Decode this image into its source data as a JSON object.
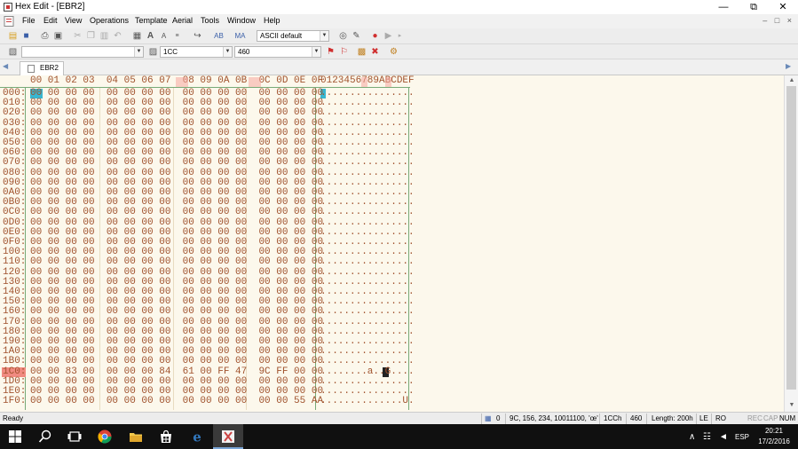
{
  "window": {
    "title": "Hex Edit - [EBR2]",
    "minimize": "—",
    "maximize": "⧉",
    "close": "✕"
  },
  "menu": {
    "items": [
      "File",
      "Edit",
      "View",
      "Operations",
      "Template",
      "Aerial",
      "Tools",
      "Window",
      "Help"
    ],
    "mdi_controls": "– □ ×"
  },
  "toolbar1": {
    "charset_combo": "ASCII default"
  },
  "toolbar2": {
    "search_combo": "",
    "address_combo": "1CC",
    "value_combo": "460"
  },
  "tabs": [
    {
      "label": "EBR2",
      "active": true
    }
  ],
  "hex": {
    "header_hex": "00 01 02 03  04 05 06 07  08 09 0A 0B  0C 0D 0E 0F",
    "header_ascii": "0123456789ABCDEF",
    "offsets": [
      "000:",
      "010:",
      "020:",
      "030:",
      "040:",
      "050:",
      "060:",
      "070:",
      "080:",
      "090:",
      "0A0:",
      "0B0:",
      "0C0:",
      "0D0:",
      "0E0:",
      "0F0:",
      "100:",
      "110:",
      "120:",
      "130:",
      "140:",
      "150:",
      "160:",
      "170:",
      "180:",
      "190:",
      "1A0:",
      "1B0:",
      "1C0:",
      "1D0:",
      "1E0:",
      "1F0:"
    ],
    "rows": [
      "00 00 00 00  00 00 00 00  00 00 00 00  00 00 00 00",
      "00 00 00 00  00 00 00 00  00 00 00 00  00 00 00 00",
      "00 00 00 00  00 00 00 00  00 00 00 00  00 00 00 00",
      "00 00 00 00  00 00 00 00  00 00 00 00  00 00 00 00",
      "00 00 00 00  00 00 00 00  00 00 00 00  00 00 00 00",
      "00 00 00 00  00 00 00 00  00 00 00 00  00 00 00 00",
      "00 00 00 00  00 00 00 00  00 00 00 00  00 00 00 00",
      "00 00 00 00  00 00 00 00  00 00 00 00  00 00 00 00",
      "00 00 00 00  00 00 00 00  00 00 00 00  00 00 00 00",
      "00 00 00 00  00 00 00 00  00 00 00 00  00 00 00 00",
      "00 00 00 00  00 00 00 00  00 00 00 00  00 00 00 00",
      "00 00 00 00  00 00 00 00  00 00 00 00  00 00 00 00",
      "00 00 00 00  00 00 00 00  00 00 00 00  00 00 00 00",
      "00 00 00 00  00 00 00 00  00 00 00 00  00 00 00 00",
      "00 00 00 00  00 00 00 00  00 00 00 00  00 00 00 00",
      "00 00 00 00  00 00 00 00  00 00 00 00  00 00 00 00",
      "00 00 00 00  00 00 00 00  00 00 00 00  00 00 00 00",
      "00 00 00 00  00 00 00 00  00 00 00 00  00 00 00 00",
      "00 00 00 00  00 00 00 00  00 00 00 00  00 00 00 00",
      "00 00 00 00  00 00 00 00  00 00 00 00  00 00 00 00",
      "00 00 00 00  00 00 00 00  00 00 00 00  00 00 00 00",
      "00 00 00 00  00 00 00 00  00 00 00 00  00 00 00 00",
      "00 00 00 00  00 00 00 00  00 00 00 00  00 00 00 00",
      "00 00 00 00  00 00 00 00  00 00 00 00  00 00 00 00",
      "00 00 00 00  00 00 00 00  00 00 00 00  00 00 00 00",
      "00 00 00 00  00 00 00 00  00 00 00 00  00 00 00 00",
      "00 00 00 00  00 00 00 00  00 00 00 00  00 00 00 00",
      "00 00 00 00  00 00 00 00  00 00 00 00  00 00 00 00",
      "00 00 83 00  00 00 00 84  61 00 FF 47  9C FF 00 00",
      "00 00 00 00  00 00 00 00  00 00 00 00  00 00 00 00",
      "00 00 00 00  00 00 00 00  00 00 00 00  00 00 00 00",
      "00 00 00 00  00 00 00 00  00 00 00 00  00 00 55 AA"
    ],
    "ascii": [
      "................",
      "................",
      "................",
      "................",
      "................",
      "................",
      "................",
      "................",
      "................",
      "................",
      "................",
      "................",
      "................",
      "................",
      "................",
      "................",
      "................",
      "................",
      "................",
      "................",
      "................",
      "................",
      "................",
      "................",
      "................",
      "................",
      "................",
      "................",
      "........a..G....",
      "................",
      "................",
      "..............U."
    ]
  },
  "status": {
    "ready": "Ready",
    "zero": "0",
    "value_repr": "9C, 156, 234, 10011100, 'œ'",
    "address": "1CCh",
    "decimal": "460",
    "length": "Length: 200h",
    "endian": "LE",
    "ro": "RO",
    "rec": "REC",
    "cap": "CAP",
    "num": "NUM"
  },
  "taskbar": {
    "language": "ESP",
    "time": "20:21",
    "date": "17/2/2016"
  },
  "colors": {
    "offset_text": "#a0522d",
    "editor_bg": "#fcf8ec",
    "selection": "#38b6d0",
    "header_highlight": "#f5a8a0"
  }
}
